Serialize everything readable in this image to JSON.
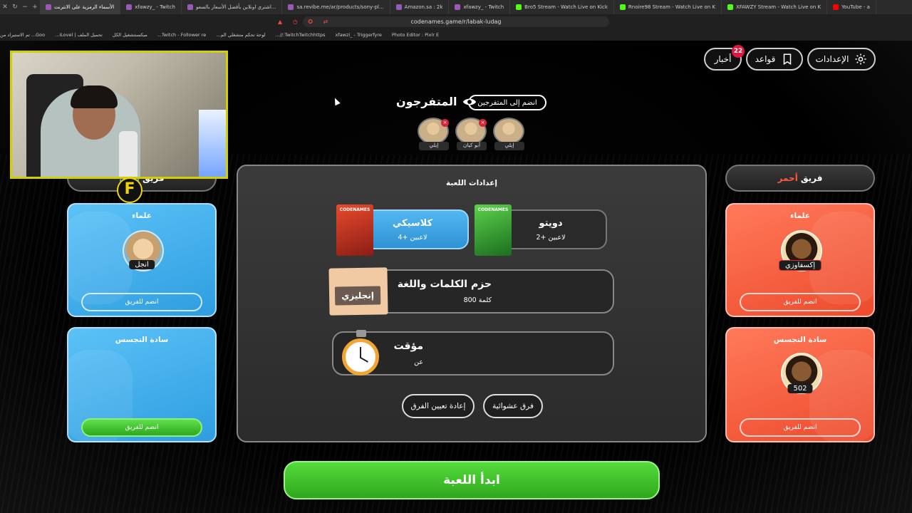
{
  "browser": {
    "tabs": [
      {
        "label": "الأسماء الرمزية على الانترنت",
        "active": true,
        "fav": "p"
      },
      {
        "label": "xfawzy_ - Twitch",
        "fav": "p"
      },
      {
        "label": "اشتري اونلاين بأفضل الأسعار بالسعو...",
        "fav": "p"
      },
      {
        "label": "sa.revibe.me/ar/products/sony-pl...",
        "fav": "p"
      },
      {
        "label": "Amazon.sa : 2k",
        "fav": "p"
      },
      {
        "label": "xfawzy_ - Twitch",
        "fav": "p"
      },
      {
        "label": "Bro5 Stream - Watch Live on Kick",
        "fav": "k"
      },
      {
        "label": "Rnoire98 Stream - Watch Live on K",
        "fav": "k"
      },
      {
        "label": "XFAWZY Stream - Watch Live on K",
        "fav": "k"
      },
      {
        "label": "YouTube - a",
        "fav": "y"
      }
    ],
    "url": "codenames.game/r/labak-ludag",
    "bookmarks": [
      "Photo Editor : Pixlr E",
      "xfawzi_ - Triggerfyre",
      "TwitchTwitchhttps://...",
      "لوحة تحكم متشغلي الم...",
      "Twitch - Follower re...",
      "ميكسنتشغيل الكل",
      "تحميل الملف | iLovel...",
      "Goo... تم الاستيراد من"
    ]
  },
  "header": {
    "settings_label": "الإعدادات",
    "rules_label": "قواعد",
    "news_label": "أخبار",
    "news_badge": "22"
  },
  "spectators": {
    "title": "المتفرجون",
    "join_label": "انضم إلى المتفرجين",
    "list": [
      {
        "name": "إيلي"
      },
      {
        "name": "أبو كيان"
      },
      {
        "name": "إيلي"
      }
    ]
  },
  "blue_team": {
    "header_color_word": "أزرق",
    "header_team_word": "فريق",
    "operatives_title": "علماء",
    "operative_name": "انجل",
    "operatives_join": "انضم للفريق",
    "spymaster_title": "سادة التجسس",
    "spymaster_join": "انضم للفريق"
  },
  "red_team": {
    "header_color_word": "أحمر",
    "header_team_word": "فريق",
    "operatives_title": "علماء",
    "operative_name": "إكسفاوزي",
    "operatives_join": "انضم للفريق",
    "spymaster_title": "سادة التجسس",
    "spymaster_name": "502",
    "spymaster_join": "انضم للفريق"
  },
  "settings": {
    "title": "إعدادات اللعبة",
    "modes": [
      {
        "name": "كلاسيكي",
        "players": "لاعبين +4",
        "selected": true,
        "box": "CODENAMES"
      },
      {
        "name": "دويتو",
        "players": "لاعبين +2",
        "selected": false,
        "box": "CODENAMES"
      }
    ],
    "wordpack_title": "حزم الكلمات واللغة",
    "wordpack_count": "800 كلمة",
    "language": "إنجليزي",
    "timer_title": "مؤقت",
    "timer_value": "عن",
    "randomize_label": "فرق عشوائية",
    "reset_label": "إعادة تعيين الفرق"
  },
  "start_label": "ابدأ اللعبة",
  "colors": {
    "blue": "#2e9de0",
    "red": "#ed4b2d",
    "green": "#2fa71c",
    "accent_yellow": "#d4d000"
  }
}
